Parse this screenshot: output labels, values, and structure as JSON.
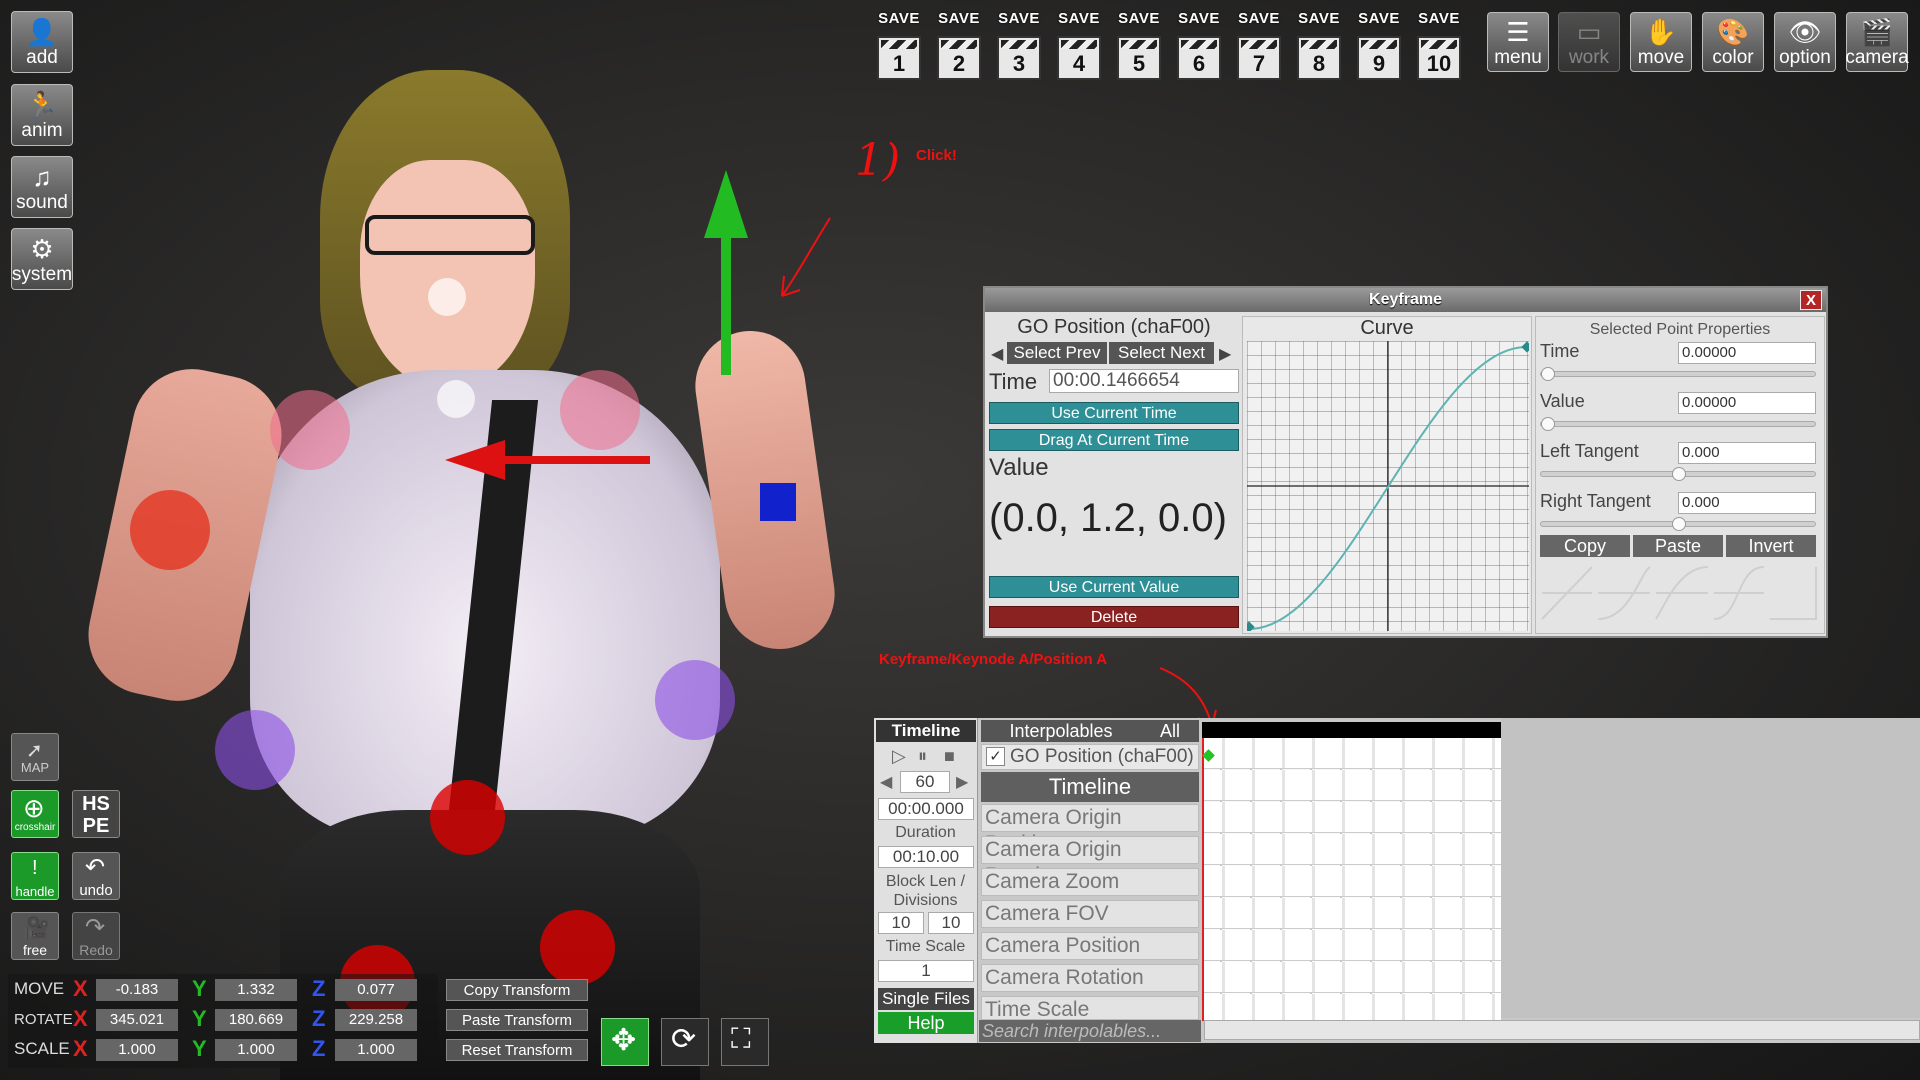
{
  "left_toolbar": {
    "items": [
      {
        "label": "add",
        "icon": "person-add-icon"
      },
      {
        "label": "anim",
        "icon": "running-figure-icon"
      },
      {
        "label": "sound",
        "icon": "music-note-icon"
      },
      {
        "label": "system",
        "icon": "gears-icon"
      }
    ]
  },
  "left_bottom_tools": {
    "map": "MAP",
    "hspe": "HS PE",
    "crosshair": "crosshair",
    "handle": "handle",
    "undo": "undo",
    "free": "free",
    "redo": "Redo"
  },
  "save_slots": [
    {
      "label": "SAVE",
      "number": "1"
    },
    {
      "label": "SAVE",
      "number": "2"
    },
    {
      "label": "SAVE",
      "number": "3"
    },
    {
      "label": "SAVE",
      "number": "4"
    },
    {
      "label": "SAVE",
      "number": "5"
    },
    {
      "label": "SAVE",
      "number": "6"
    },
    {
      "label": "SAVE",
      "number": "7"
    },
    {
      "label": "SAVE",
      "number": "8"
    },
    {
      "label": "SAVE",
      "number": "9"
    },
    {
      "label": "SAVE",
      "number": "10"
    }
  ],
  "top_tools": [
    {
      "label": "menu",
      "icon": "list-icon"
    },
    {
      "label": "work",
      "icon": "window-icon"
    },
    {
      "label": "move",
      "icon": "hand-icon"
    },
    {
      "label": "color",
      "icon": "palette-icon"
    },
    {
      "label": "option",
      "icon": "eye-icon"
    },
    {
      "label": "camera",
      "icon": "clapperboard-icon"
    }
  ],
  "annotations": {
    "step": "1)",
    "click": "Click!",
    "keyframe_note": "Keyframe/Keynode A/Position A"
  },
  "keyframe": {
    "title": "Keyframe",
    "close": "X",
    "target": "GO Position (chaF00)",
    "select_prev": "Select Prev",
    "select_next": "Select Next",
    "time_label": "Time",
    "time_value": "00:00.1466654",
    "use_current_time": "Use Current Time",
    "drag_at_current_time": "Drag At Current Time",
    "value_label": "Value",
    "value": "(0.0, 1.2, 0.0)",
    "use_current_value": "Use Current Value",
    "delete": "Delete",
    "curve_title": "Curve",
    "props_title": "Selected Point Properties",
    "props": {
      "time_label": "Time",
      "time_value": "0.00000",
      "value_label": "Value",
      "value_value": "0.00000",
      "left_tangent_label": "Left Tangent",
      "left_tangent_value": "0.000",
      "right_tangent_label": "Right Tangent",
      "right_tangent_value": "0.000",
      "copy": "Copy",
      "paste": "Paste",
      "invert": "Invert"
    }
  },
  "timeline": {
    "tab_timeline": "Timeline",
    "tab_interpolables": "Interpolables",
    "tab_all": "All",
    "fps": "60",
    "current_time": "00:00.000",
    "duration_label": "Duration",
    "duration": "00:10.00",
    "block_len_label": "Block Len / Divisions",
    "block_len": "10",
    "divisions": "10",
    "time_scale_label": "Time Scale",
    "time_scale": "1",
    "single_files": "Single Files",
    "help": "Help",
    "search_placeholder": "Search interpolables...",
    "go_position": "GO Position (chaF00)",
    "group_header": "Timeline",
    "interpolables": [
      "Camera Origin Position",
      "Camera Origin Rotation",
      "Camera Zoom",
      "Camera FOV",
      "Camera Position",
      "Camera Rotation",
      "Time Scale"
    ]
  },
  "transform": {
    "move": {
      "label": "MOVE",
      "x": "-0.183",
      "y": "1.332",
      "z": "0.077"
    },
    "rotate": {
      "label": "ROTATE",
      "x": "345.021",
      "y": "180.669",
      "z": "229.258"
    },
    "scale": {
      "label": "SCALE",
      "x": "1.000",
      "y": "1.000",
      "z": "1.000"
    },
    "axis_x": "X",
    "axis_y": "Y",
    "axis_z": "Z",
    "copy_transform": "Copy Transform",
    "paste_transform": "Paste Transform",
    "reset_transform": "Reset Transform"
  },
  "colors": {
    "gizmo_y": "#22bb22",
    "gizmo_x": "#dd1111",
    "gizmo_z": "#1122cc",
    "teal_button": "#2e8f96",
    "delete_button": "#8a2222",
    "help_button": "#1a9e2a"
  }
}
